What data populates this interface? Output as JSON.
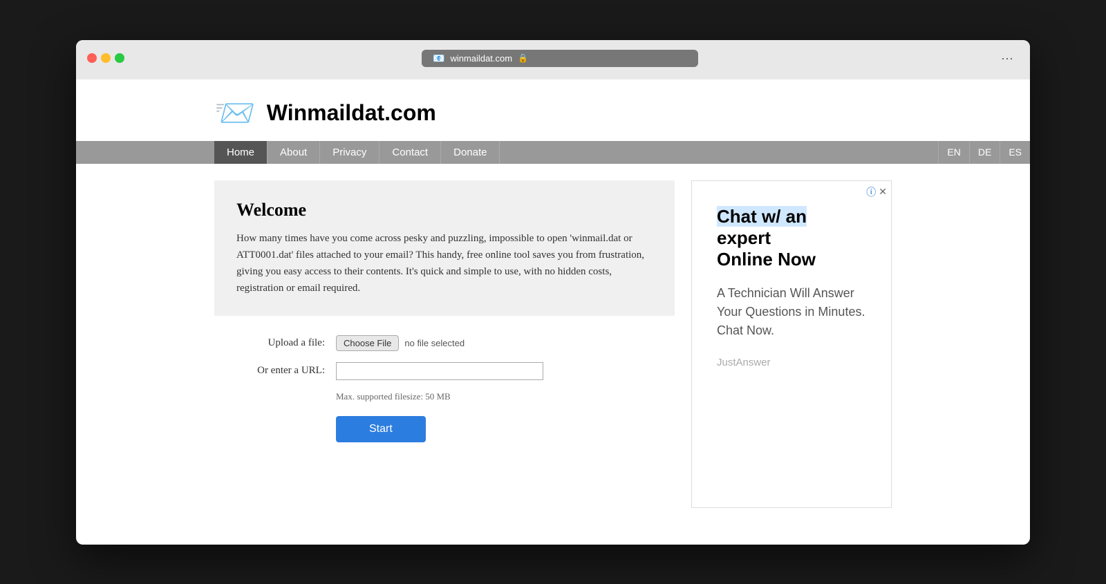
{
  "browser": {
    "address": "winmaildat.com",
    "lock_symbol": "🔒",
    "site_icon": "📧"
  },
  "header": {
    "logo_emoji": "📨",
    "title": "Winmaildat.com"
  },
  "nav": {
    "items": [
      {
        "label": "Home",
        "active": true
      },
      {
        "label": "About"
      },
      {
        "label": "Privacy"
      },
      {
        "label": "Contact"
      },
      {
        "label": "Donate"
      }
    ],
    "languages": [
      {
        "label": "EN"
      },
      {
        "label": "DE"
      },
      {
        "label": "ES"
      }
    ]
  },
  "welcome": {
    "title": "Welcome",
    "body": "How many times have you come across pesky and puzzling, impossible to open 'winmail.dat or ATT0001.dat' files attached to your email? This handy, free online tool saves you from frustration, giving you easy access to their contents. It's quick and simple to use, with no hidden costs, registration or email required."
  },
  "form": {
    "upload_label": "Upload a file:",
    "choose_file_btn": "Choose File",
    "no_file_text": "no file selected",
    "url_label": "Or enter a URL:",
    "url_placeholder": "",
    "file_size_note": "Max. supported filesize: 50 MB",
    "start_btn": "Start"
  },
  "ad": {
    "headline_part1": "Chat w/ an",
    "headline_part2": "expert",
    "headline_part3": "Online Now",
    "body": "A Technician Will Answer Your Questions in Minutes. Chat Now.",
    "source": "JustAnswer"
  }
}
